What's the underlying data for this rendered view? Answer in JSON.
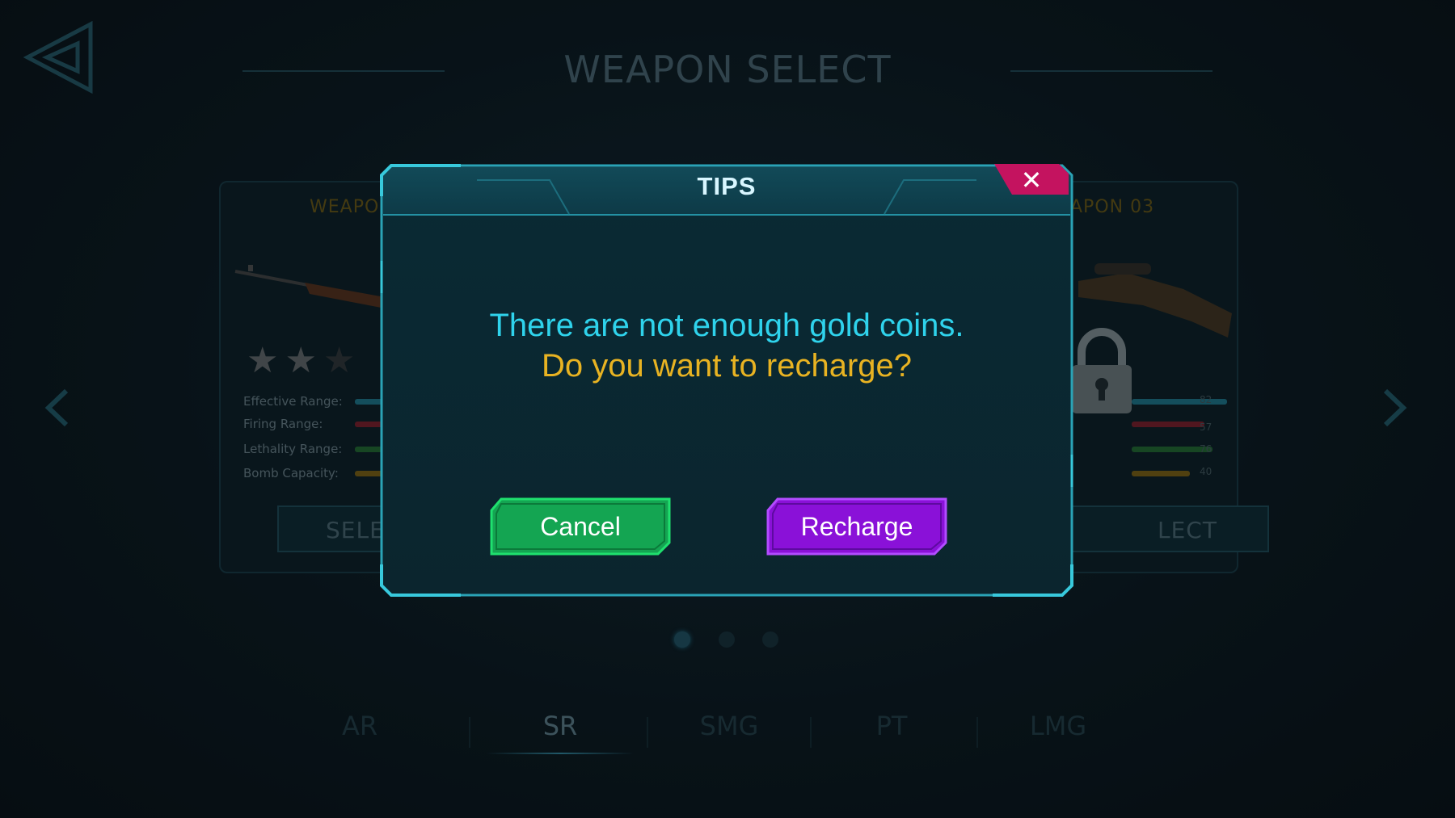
{
  "header": {
    "title": "WEAPON SELECT"
  },
  "cards": [
    {
      "title": "WEAPO",
      "stars": {
        "filled": 2,
        "total": 3
      },
      "stats": [
        {
          "label": "Effective Range:"
        },
        {
          "label": "Firing Range:"
        },
        {
          "label": "Lethality Range:"
        },
        {
          "label": "Bomb Capacity:"
        }
      ],
      "select_label": "SELEC"
    },
    {
      "title": "APON 03",
      "stats": [
        {
          "value": "82"
        },
        {
          "value": "57"
        },
        {
          "value": "76"
        },
        {
          "value": "40"
        }
      ],
      "select_label": "LECT",
      "locked": true
    }
  ],
  "pager": {
    "total": 3,
    "active": 0
  },
  "tabs": [
    {
      "label": "AR"
    },
    {
      "label": "SR",
      "active": true
    },
    {
      "label": "SMG"
    },
    {
      "label": "PT"
    },
    {
      "label": "LMG"
    }
  ],
  "dialog": {
    "title": "TIPS",
    "close_icon": "close-icon",
    "message_line1": "There are not enough gold coins.",
    "message_line2": "Do you want to recharge?",
    "cancel_label": "Cancel",
    "recharge_label": "Recharge"
  },
  "colors": {
    "message_primary": "#2fd3ec",
    "message_secondary": "#e8b322",
    "cancel_button": "#14a552",
    "recharge_button": "#8a11d8",
    "close_button": "#c4135f",
    "dialog_border": "#2aa3b6"
  }
}
